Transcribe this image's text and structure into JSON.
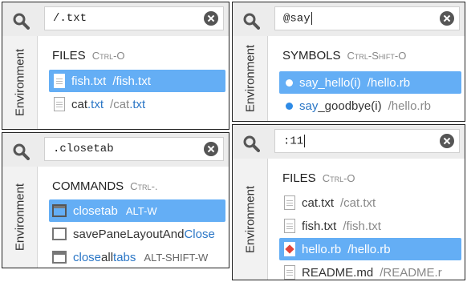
{
  "side_label": "Environment",
  "panels": [
    {
      "query": "/.txt",
      "section": "FILES",
      "shortcut": "Ctrl-O",
      "rows": [
        {
          "main": "fish.txt",
          "path": "/fish.txt",
          "selected": true
        },
        {
          "main_pre": "cat",
          "main_hl": ".txt",
          "path_pre": "/cat",
          "path_hl": ".txt"
        }
      ]
    },
    {
      "query": "@say",
      "section": "SYMBOLS",
      "shortcut": "Ctrl-Shift-O",
      "rows": [
        {
          "main": "say_hello(i)",
          "path": "/hello.rb",
          "selected": true
        },
        {
          "main_hl": "say",
          "main_post": "_goodbye(i)",
          "path": "/hello.rb"
        }
      ]
    },
    {
      "query": ".closetab",
      "section": "COMMANDS",
      "shortcut": "Ctrl-.",
      "rows": [
        {
          "main": "closetab",
          "kbd": "ALT-W",
          "selected": true
        },
        {
          "main_pre": "savePaneLayoutAnd",
          "main_hl": "Close"
        },
        {
          "main_hl": "close",
          "main_mid": "all",
          "main_hl2": "tabs",
          "kbd": "ALT-SHIFT-W"
        }
      ]
    },
    {
      "query": ":11",
      "section": "FILES",
      "shortcut": "Ctrl-O",
      "rows": [
        {
          "main": "cat.txt",
          "path": "/cat.txt"
        },
        {
          "main": "fish.txt",
          "path": "/fish.txt"
        },
        {
          "main": "hello.rb",
          "path": "/hello.rb",
          "selected": true
        },
        {
          "main": "README.md",
          "path": "/README.r"
        }
      ]
    }
  ],
  "icons": {
    "search": "search-icon",
    "clear": "clear-icon",
    "file": "file-icon",
    "ruby": "ruby-file-icon",
    "symbol": "symbol-dot-icon",
    "command": "tab-icon",
    "window": "window-icon"
  }
}
